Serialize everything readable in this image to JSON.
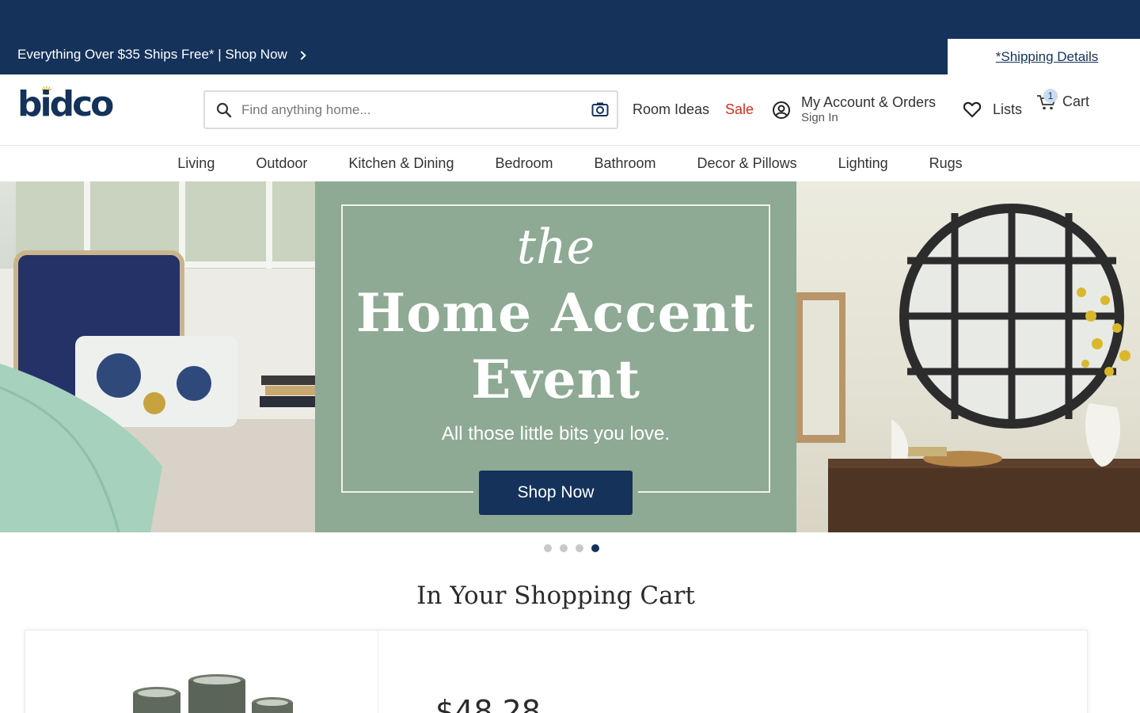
{
  "promo": {
    "text": "Everything Over $35 Ships Free* | Shop Now",
    "shipping_link": "*Shipping Details"
  },
  "header": {
    "logo_text": "bidco",
    "search_placeholder": "Find anything home...",
    "room_ideas": "Room Ideas",
    "sale": "Sale",
    "account_title": "My Account & Orders",
    "account_sub": "Sign In",
    "lists": "Lists",
    "cart_label": "Cart",
    "cart_count": "1"
  },
  "categories": [
    "Living",
    "Outdoor",
    "Kitchen & Dining",
    "Bedroom",
    "Bathroom",
    "Decor & Pillows",
    "Lighting",
    "Rugs"
  ],
  "hero": {
    "the": "the",
    "headline_line1": "Home Accent",
    "headline_line2": "Event",
    "tagline": "All those little bits you love.",
    "button": "Shop Now",
    "slide_count": 4,
    "active_slide": 4
  },
  "cart_section": {
    "title": "In Your Shopping Cart",
    "price": "$48.28"
  },
  "colors": {
    "navy": "#14325a",
    "sale_red": "#c8321e",
    "hero_green": "#8ea994"
  }
}
